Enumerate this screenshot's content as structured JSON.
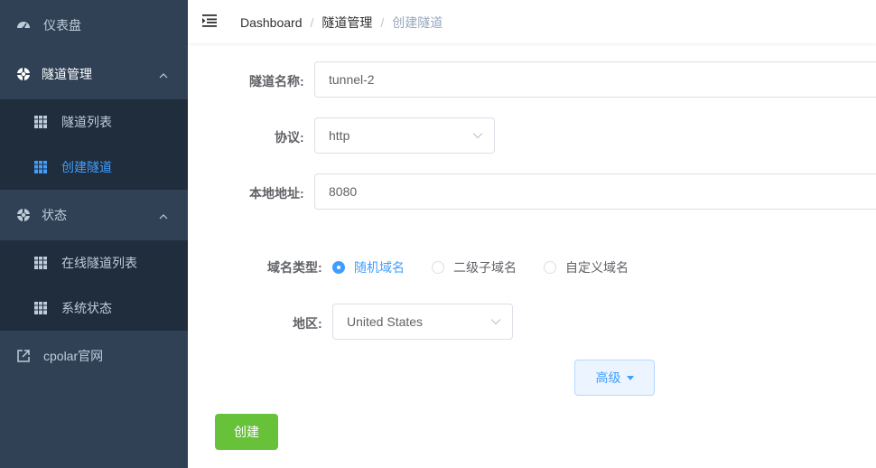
{
  "sidebar": {
    "items": [
      {
        "label": "仪表盘",
        "icon": "dashboard-icon"
      },
      {
        "label": "隧道管理",
        "icon": "lifebuoy-icon",
        "children": [
          {
            "label": "隧道列表",
            "icon": "grid-icon"
          },
          {
            "label": "创建隧道",
            "icon": "grid-icon",
            "active": true
          }
        ]
      },
      {
        "label": "状态",
        "icon": "lifebuoy-icon",
        "children": [
          {
            "label": "在线隧道列表",
            "icon": "grid-icon"
          },
          {
            "label": "系统状态",
            "icon": "grid-icon"
          }
        ]
      },
      {
        "label": "cpolar官网",
        "icon": "external-link-icon"
      }
    ]
  },
  "breadcrumb": {
    "home": "Dashboard",
    "parent": "隧道管理",
    "current": "创建隧道",
    "separator": "/"
  },
  "form": {
    "tunnel_name": {
      "label": "隧道名称:",
      "value": "tunnel-2"
    },
    "protocol": {
      "label": "协议:",
      "value": "http"
    },
    "local_address": {
      "label": "本地地址:",
      "value": "8080"
    },
    "domain_type": {
      "label": "域名类型:",
      "options": [
        "随机域名",
        "二级子域名",
        "自定义域名"
      ],
      "selected": "随机域名"
    },
    "region": {
      "label": "地区:",
      "value": "United States"
    },
    "advanced_label": "高级",
    "create_label": "创建"
  },
  "colors": {
    "sidebar_bg": "#304156",
    "submenu_bg": "#1f2d3d",
    "active": "#409eff",
    "create": "#67c23a"
  }
}
